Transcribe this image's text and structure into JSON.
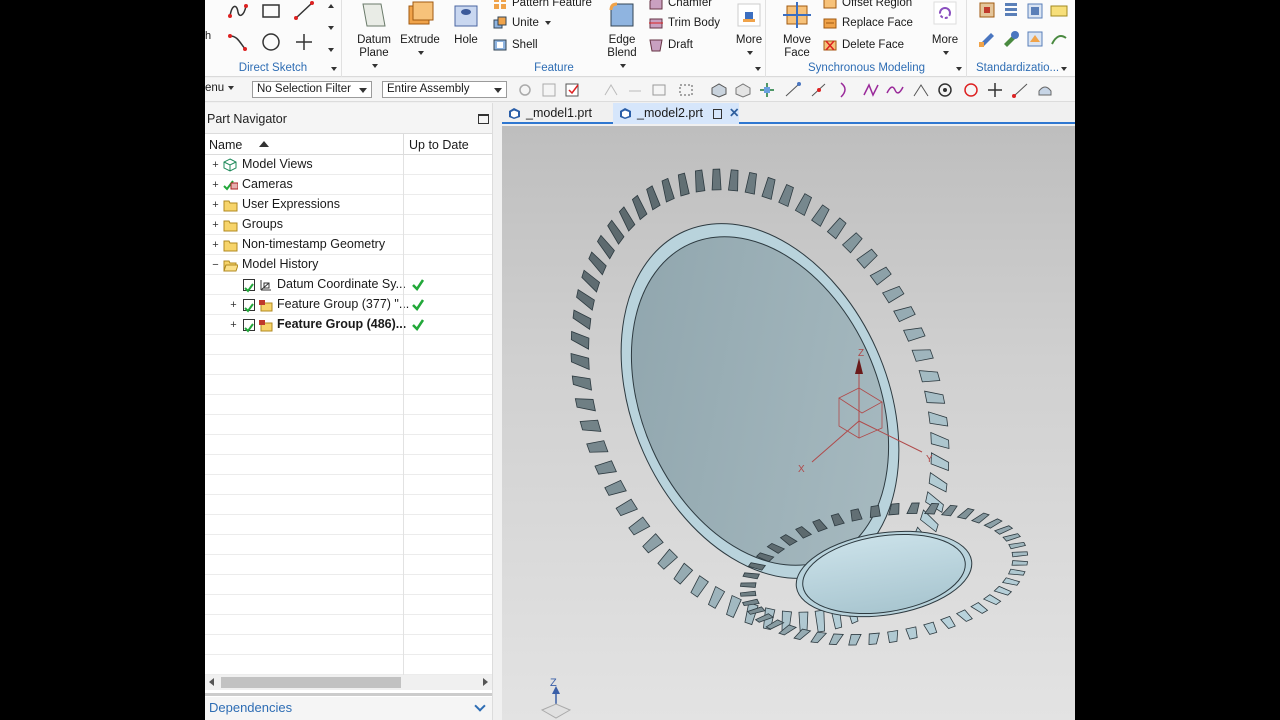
{
  "ribbon": {
    "direct_sketch": {
      "label": "Direct Sketch"
    },
    "feature": {
      "label": "Feature",
      "datum_plane": "Datum Plane",
      "extrude": "Extrude",
      "hole": "Hole",
      "pattern_feature": "Pattern Feature",
      "unite": "Unite",
      "shell": "Shell",
      "edge_blend": "Edge Blend",
      "chamfer": "Chamfer",
      "trim_body": "Trim Body",
      "draft": "Draft",
      "more": "More"
    },
    "synchronous_modeling": {
      "label": "Synchronous Modeling",
      "move_face": "Move Face",
      "offset_region": "Offset Region",
      "replace_face": "Replace Face",
      "delete_face": "Delete Face",
      "more": "More"
    },
    "standardization": {
      "label": "Standardizatio..."
    }
  },
  "selection_bar": {
    "menu_label": "enu",
    "selection_filter": "No Selection Filter",
    "scope": "Entire Assembly"
  },
  "part_navigator": {
    "title": "Part Navigator",
    "columns": {
      "name": "Name",
      "up_to_date": "Up to Date"
    },
    "items": [
      {
        "label": "Model Views",
        "icon": "model-views-icon",
        "expander": "+",
        "indent": 0,
        "check": false,
        "uptodate": false,
        "bold": false
      },
      {
        "label": "Cameras",
        "icon": "camera-icon",
        "expander": "+",
        "indent": 0,
        "check": false,
        "uptodate": false,
        "bold": false
      },
      {
        "label": "User Expressions",
        "icon": "folder-icon",
        "expander": "+",
        "indent": 0,
        "check": false,
        "uptodate": false,
        "bold": false
      },
      {
        "label": "Groups",
        "icon": "folder-icon",
        "expander": "+",
        "indent": 0,
        "check": false,
        "uptodate": false,
        "bold": false
      },
      {
        "label": "Non-timestamp Geometry",
        "icon": "folder-icon",
        "expander": "+",
        "indent": 0,
        "check": false,
        "uptodate": false,
        "bold": false
      },
      {
        "label": "Model History",
        "icon": "folder-open-icon",
        "expander": "−",
        "indent": 0,
        "check": false,
        "uptodate": false,
        "bold": false
      },
      {
        "label": "Datum Coordinate Sy...",
        "icon": "datum-csys-icon",
        "expander": "",
        "indent": 1,
        "check": true,
        "uptodate": true,
        "bold": false
      },
      {
        "label": "Feature Group (377) \"...",
        "icon": "feature-group-icon",
        "expander": "+",
        "indent": 1,
        "check": true,
        "uptodate": true,
        "bold": false
      },
      {
        "label": "Feature Group (486)...",
        "icon": "feature-group-icon",
        "expander": "+",
        "indent": 1,
        "check": true,
        "uptodate": true,
        "bold": true
      }
    ],
    "dependencies": "Dependencies"
  },
  "tabs": [
    {
      "label": "_model1.prt",
      "active": false
    },
    {
      "label": "_model2.prt",
      "active": true
    }
  ],
  "viewport": {
    "axis_x": "X",
    "axis_y": "Y",
    "axis_z": "Z",
    "triad_z": "Z"
  },
  "colors": {
    "accent": "#2e6db4",
    "tab_underline": "#2f77d0",
    "gear": "#b9d3dc",
    "gear_face": "#9db2ba",
    "check_green": "#22a83a"
  }
}
